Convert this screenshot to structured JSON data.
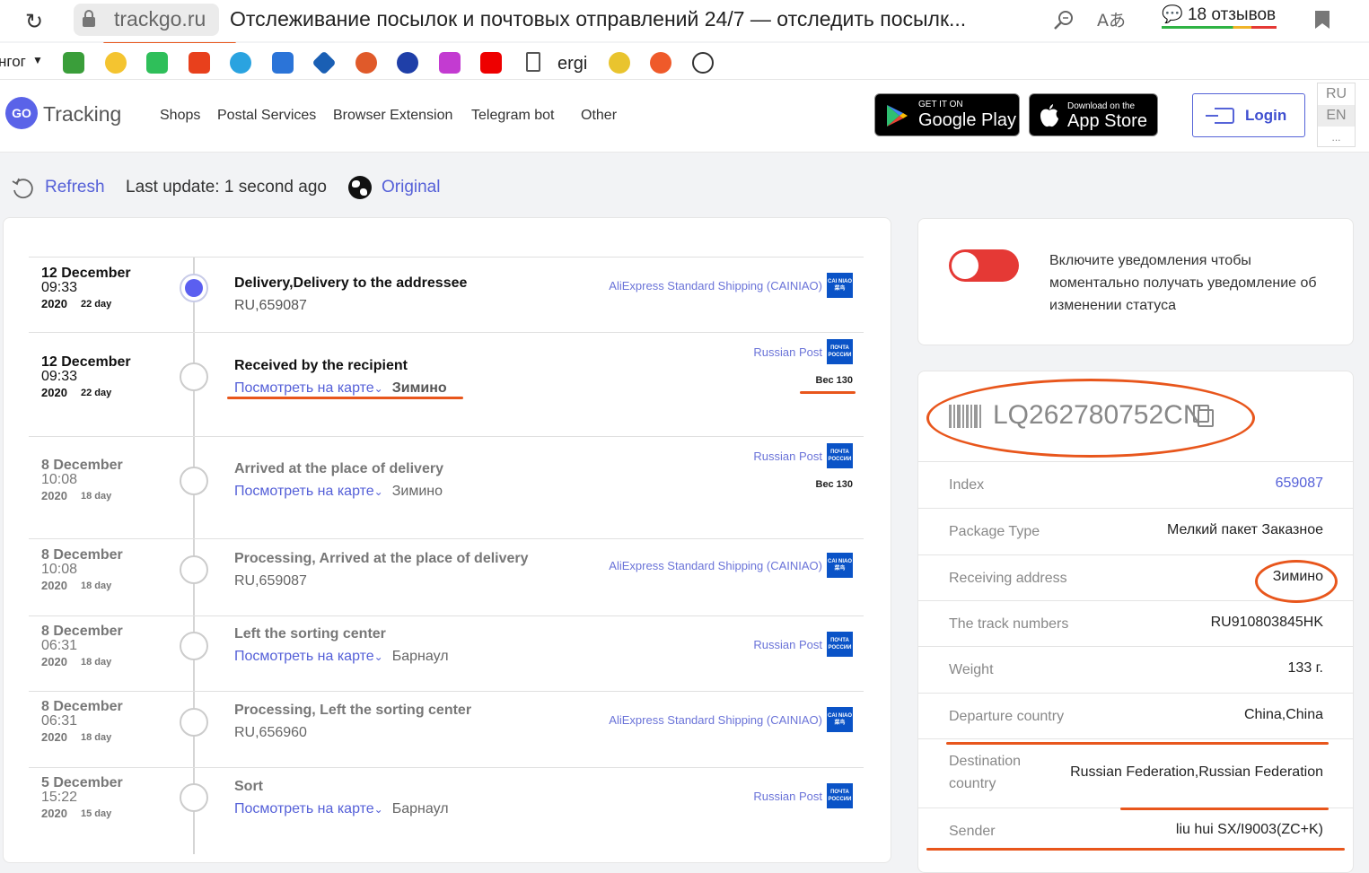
{
  "browser": {
    "url": "trackgo.ru",
    "title": "Отслеживание посылок и почтовых отправлений 24/7 — отследить посылк...",
    "reviews_label": "18 отзывов",
    "bookmarks_first": "нгог",
    "bookmark_label": "ergi"
  },
  "site": {
    "logo_badge": "GO",
    "logo_text": "Tracking",
    "nav": [
      "Shops",
      "Postal Services",
      "Browser Extension",
      "Telegram bot",
      "Other"
    ],
    "google_play": {
      "small": "GET IT ON",
      "big": "Google Play"
    },
    "app_store": {
      "small": "Download on the",
      "big": "App Store"
    },
    "login": "Login",
    "langs": [
      "RU",
      "EN",
      "..."
    ]
  },
  "toolbar": {
    "refresh": "Refresh",
    "last_update": "Last update: 1 second ago",
    "original": "Original"
  },
  "events": [
    {
      "date": "12 December",
      "time": "09:33",
      "year": "2020",
      "day": "22 day",
      "title": "Delivery,Delivery to the addressee",
      "sub": "RU,659087",
      "map": "",
      "carrier": "AliExpress Standard Shipping (CAINIAO)",
      "logo": "cainiao",
      "weight": ""
    },
    {
      "date": "12 December",
      "time": "09:33",
      "year": "2020",
      "day": "22 day",
      "title": "Received by the recipient",
      "sub": "Зимино",
      "map": "Посмотреть на карте",
      "carrier": "Russian Post",
      "logo": "russianpost",
      "weight": "Вес 130"
    },
    {
      "date": "8 December",
      "time": "10:08",
      "year": "2020",
      "day": "18 day",
      "title": "Arrived at the place of delivery",
      "sub": "Зимино",
      "map": "Посмотреть на карте",
      "carrier": "Russian Post",
      "logo": "russianpost",
      "weight": "Вес 130"
    },
    {
      "date": "8 December",
      "time": "10:08",
      "year": "2020",
      "day": "18 day",
      "title": "Processing, Arrived at the place of delivery",
      "sub": "RU,659087",
      "map": "",
      "carrier": "AliExpress Standard Shipping (CAINIAO)",
      "logo": "cainiao",
      "weight": ""
    },
    {
      "date": "8 December",
      "time": "06:31",
      "year": "2020",
      "day": "18 day",
      "title": "Left the sorting center",
      "sub": "Барнаул",
      "map": "Посмотреть на карте",
      "carrier": "Russian Post",
      "logo": "russianpost",
      "weight": ""
    },
    {
      "date": "8 December",
      "time": "06:31",
      "year": "2020",
      "day": "18 day",
      "title": "Processing, Left the sorting center",
      "sub": "RU,656960",
      "map": "",
      "carrier": "AliExpress Standard Shipping (CAINIAO)",
      "logo": "cainiao",
      "weight": ""
    },
    {
      "date": "5 December",
      "time": "15:22",
      "year": "2020",
      "day": "15 day",
      "title": "Sort",
      "sub": "Барнаул",
      "map": "Посмотреть на карте",
      "carrier": "Russian Post",
      "logo": "russianpost",
      "weight": ""
    }
  ],
  "logo_text": {
    "russianpost": "ПОЧТА РОССИИ",
    "cainiao": "CAI NIAO 菜鸟"
  },
  "notify": {
    "text": "Включите уведомления чтобы моментально получать уведомление об изменении статуса",
    "enabled": false
  },
  "tracking": {
    "number": "LQ262780752CN",
    "rows": [
      {
        "key": "Index",
        "value": "659087"
      },
      {
        "key": "Package Type",
        "value": "Мелкий пакет Заказное"
      },
      {
        "key": "Receiving address",
        "value": "Зимино"
      },
      {
        "key": "The track numbers",
        "value": "RU910803845HK"
      },
      {
        "key": "Weight",
        "value": "133 г."
      },
      {
        "key": "Departure country",
        "value": "China,China"
      },
      {
        "key": "Destination country",
        "value": "Russian Federation,Russian Federation"
      },
      {
        "key": "Sender",
        "value": "liu hui SX/I9003(ZC+K)"
      }
    ]
  },
  "colors": {
    "accent": "#5560d8",
    "annotation": "#e8561c",
    "toggle_off": "#e53935"
  }
}
